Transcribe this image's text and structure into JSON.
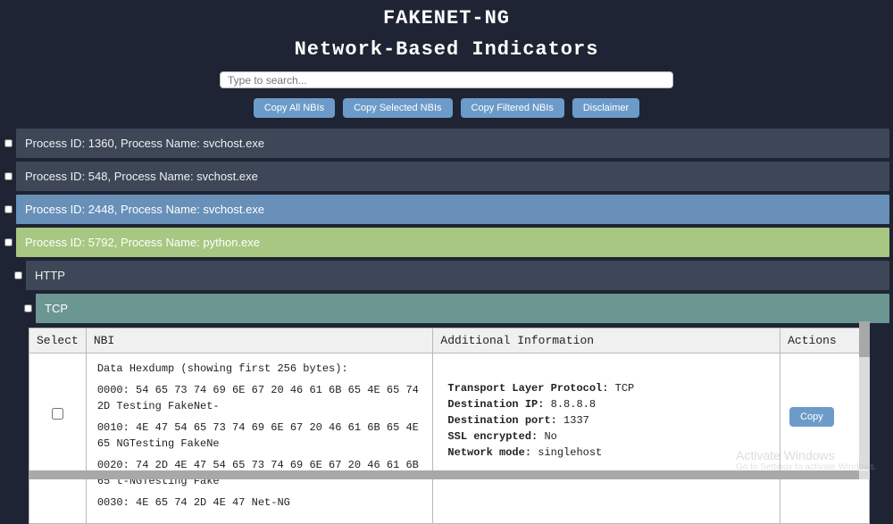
{
  "header": {
    "title": "FAKENET-NG",
    "subtitle": "Network-Based Indicators"
  },
  "search": {
    "placeholder": "Type to search...",
    "value": ""
  },
  "buttons": {
    "copy_all": "Copy All NBIs",
    "copy_selected": "Copy Selected NBIs",
    "copy_filtered": "Copy Filtered NBIs",
    "disclaimer": "Disclaimer"
  },
  "process_rows": [
    {
      "label": "Process ID: 1360, Process Name: svchost.exe",
      "style": "dark"
    },
    {
      "label": "Process ID: 548, Process Name: svchost.exe",
      "style": "dark"
    },
    {
      "label": "Process ID: 2448, Process Name: svchost.exe",
      "style": "blue"
    },
    {
      "label": "Process ID: 5792, Process Name: python.exe",
      "style": "green"
    }
  ],
  "protocol_rows": [
    {
      "label": "HTTP",
      "style": "dark"
    },
    {
      "label": "TCP",
      "style": "teal"
    }
  ],
  "table": {
    "headers": {
      "select": "Select",
      "nbi": "NBI",
      "additional": "Additional Information",
      "actions": "Actions"
    },
    "row": {
      "hex_title": "Data Hexdump (showing first 256 bytes):",
      "hex_lines": [
        "0000: 54 65 73 74 69 6E 67 20 46 61 6B 65 4E 65 74 2D Testing FakeNet-",
        "0010: 4E 47 54 65 73 74 69 6E 67 20 46 61 6B 65 4E 65 NGTesting FakeNe",
        "0020: 74 2D 4E 47 54 65 73 74 69 6E 67 20 46 61 6B 65 t-NGTesting Fake",
        "0030: 4E 65 74 2D 4E 47 Net-NG"
      ],
      "additional": {
        "protocol_label": "Transport Layer Protocol:",
        "protocol_value": "TCP",
        "dest_ip_label": "Destination IP:",
        "dest_ip_value": "8.8.8.8",
        "dest_port_label": "Destination port:",
        "dest_port_value": "1337",
        "ssl_label": "SSL encrypted:",
        "ssl_value": "No",
        "mode_label": "Network mode:",
        "mode_value": "singlehost"
      },
      "copy_label": "Copy"
    }
  },
  "watermark": {
    "line1": "Activate Windows",
    "line2": "Go to Settings to activate Windows."
  }
}
